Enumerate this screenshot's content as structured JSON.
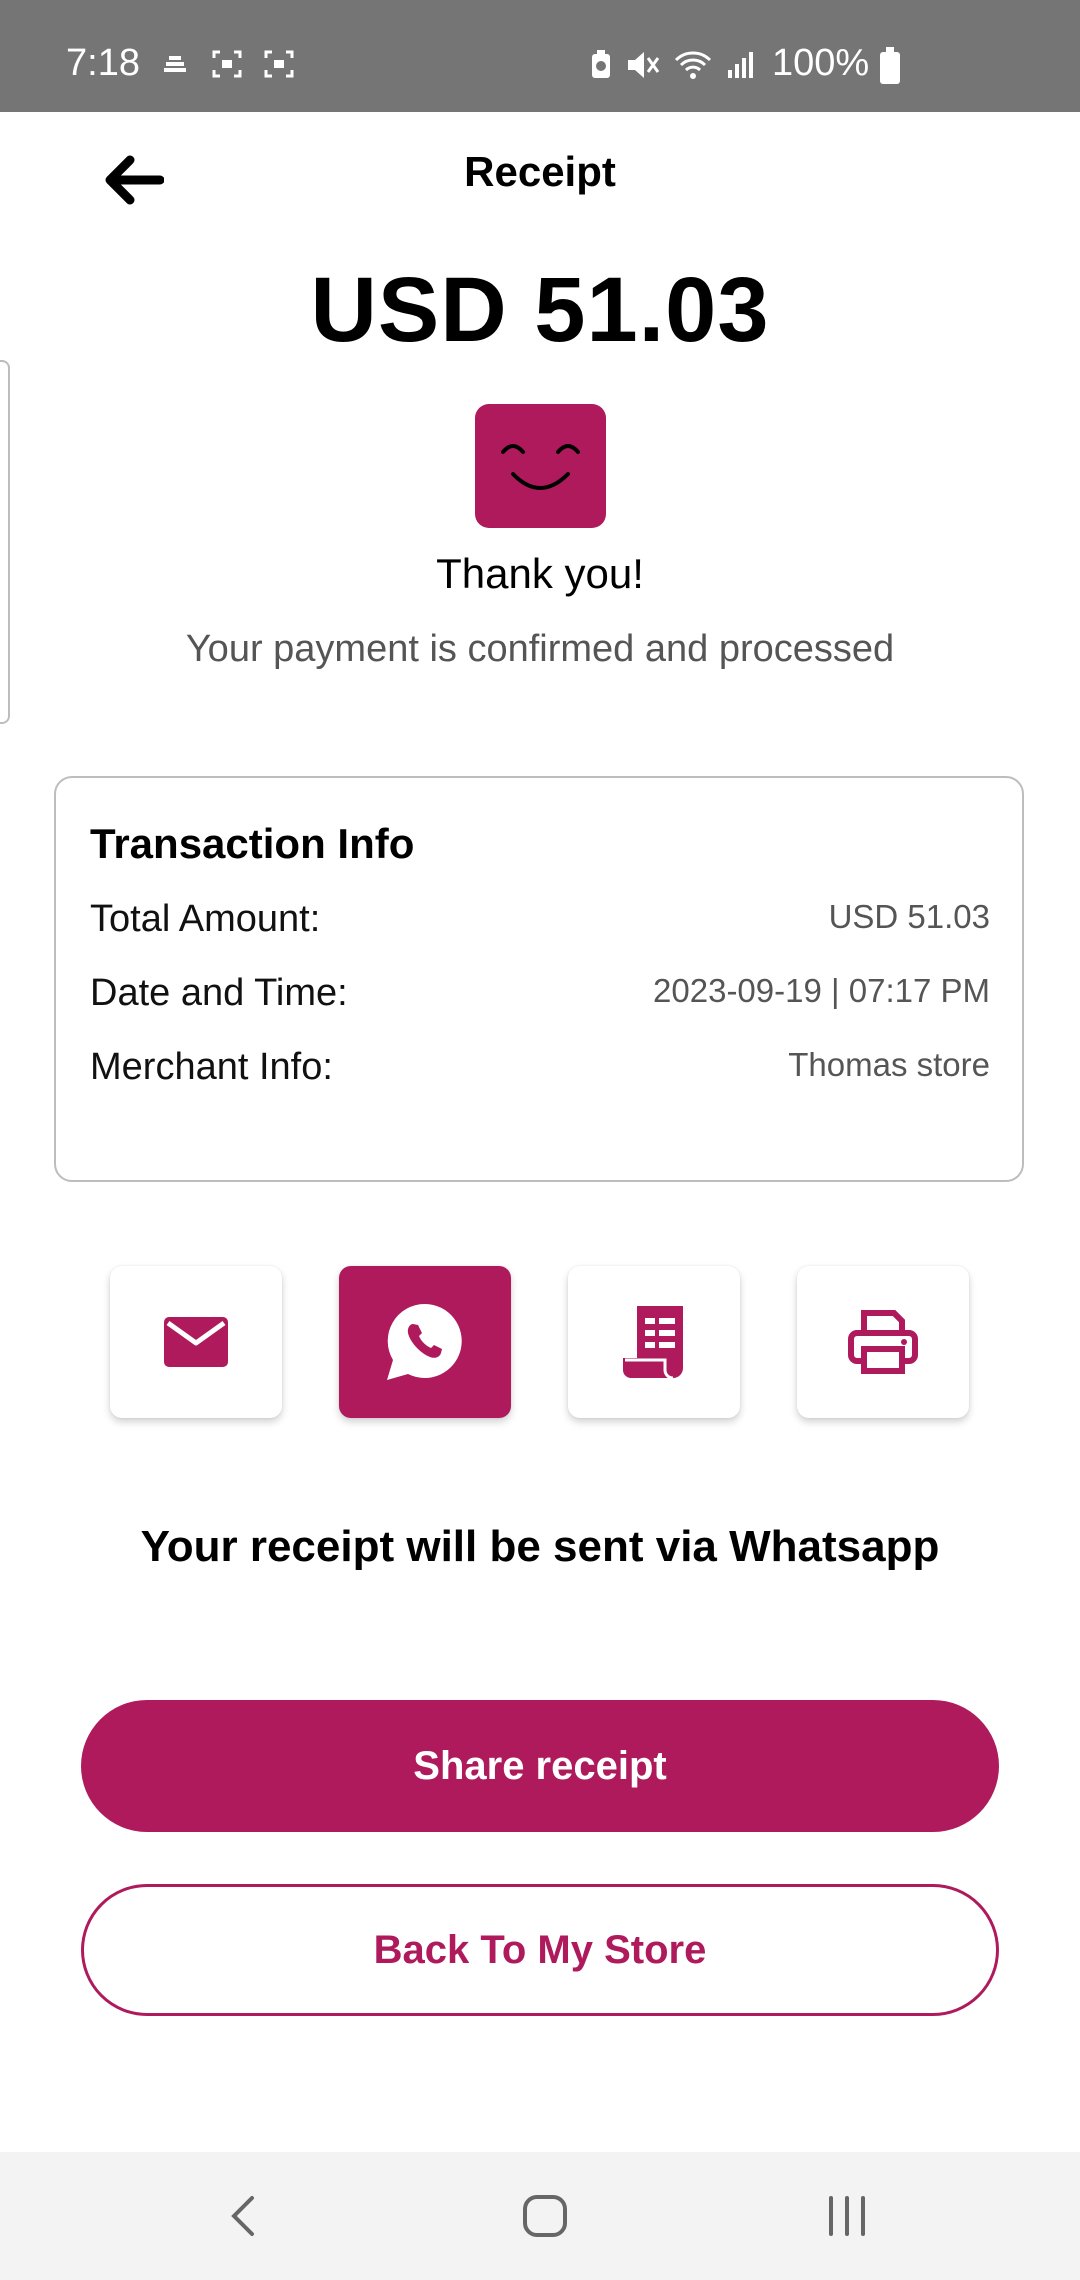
{
  "status_bar": {
    "time": "7:18",
    "battery": "100%",
    "icons": [
      "cloud-icon",
      "screen-record-icon",
      "screen-record-icon",
      "battery-saver-icon",
      "mute-icon",
      "wifi-icon",
      "signal-icon",
      "battery-icon"
    ]
  },
  "header": {
    "title": "Receipt",
    "back_icon": "arrow-left-icon"
  },
  "summary": {
    "amount": "USD 51.03",
    "icon": "smiley-icon",
    "thanks": "Thank you!",
    "message": "Your payment is confirmed and processed"
  },
  "transaction": {
    "title": "Transaction Info",
    "rows": [
      {
        "label": "Total Amount:",
        "value": "USD 51.03"
      },
      {
        "label": "Date and Time:",
        "value": "2023-09-19 | 07:17 PM"
      },
      {
        "label": "Merchant Info:",
        "value": "Thomas store"
      }
    ]
  },
  "share_options": [
    {
      "icon": "email-icon",
      "selected": false
    },
    {
      "icon": "whatsapp-icon",
      "selected": true
    },
    {
      "icon": "receipt-icon",
      "selected": false
    },
    {
      "icon": "printer-icon",
      "selected": false
    }
  ],
  "share_message": "Your receipt will be sent via Whatsapp",
  "buttons": {
    "primary": "Share receipt",
    "secondary": "Back To My Store"
  },
  "navbar": {
    "back_icon": "nav-back-icon",
    "home_icon": "nav-home-icon",
    "recents_icon": "nav-recents-icon"
  },
  "colors": {
    "accent": "#ae1a5c",
    "status_bar": "#757575"
  }
}
